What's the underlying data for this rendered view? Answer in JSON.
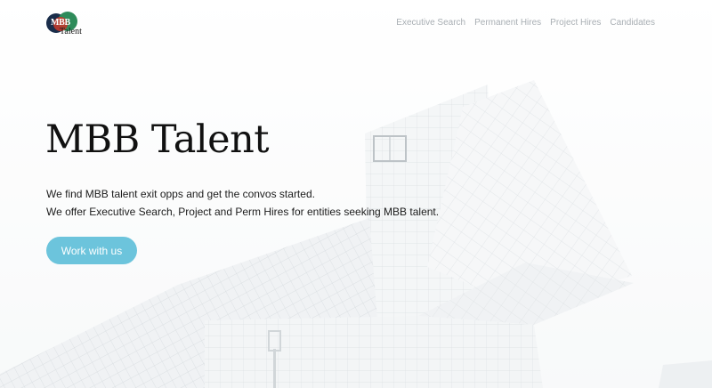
{
  "logo": {
    "mark": "MBB",
    "word": "Talent"
  },
  "nav": {
    "items": [
      {
        "label": "Executive Search"
      },
      {
        "label": "Permanent Hires"
      },
      {
        "label": "Project Hires"
      },
      {
        "label": "Candidates"
      }
    ]
  },
  "hero": {
    "title": "MBB Talent",
    "line1": "We find MBB talent exit opps and get the convos started.",
    "line2": "We offer Executive Search, Project and Perm Hires for entities seeking MBB talent.",
    "cta_label": "Work with us"
  },
  "colors": {
    "cta": "#6cc4dc",
    "nav_text": "#a8aeb3",
    "logo_navy": "#1a2d4a",
    "logo_green": "#2e8b5a",
    "logo_red": "#c0392b"
  }
}
